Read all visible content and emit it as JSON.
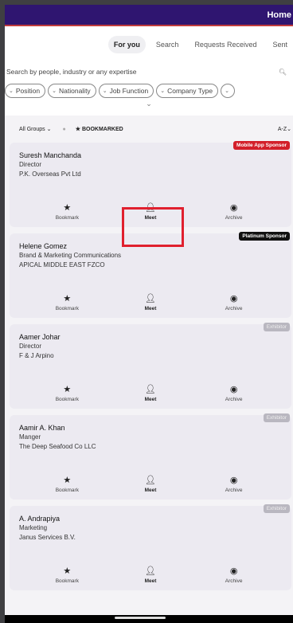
{
  "header": {
    "title": "Home"
  },
  "tabs": [
    {
      "label": "For you",
      "active": true
    },
    {
      "label": "Search",
      "active": false
    },
    {
      "label": "Requests Received",
      "active": false
    },
    {
      "label": "Sent",
      "active": false
    }
  ],
  "search": {
    "placeholder": "Search by people, industry or any expertise"
  },
  "filters": [
    "Position",
    "Nationality",
    "Job Function",
    "Company Type",
    ""
  ],
  "filter_bar": {
    "groups": "All Groups",
    "bookmarked": "★ BOOKMARKED",
    "sort": "A-Z"
  },
  "actions": {
    "bookmark": "Bookmark",
    "meet": "Meet",
    "archive": "Archive"
  },
  "cards": [
    {
      "name": "Suresh Manchanda",
      "title": "Director",
      "company": "P.K. Overseas Pvt Ltd",
      "badge": "Mobile App Sponsor",
      "badge_style": "red"
    },
    {
      "name": "Helene Gomez",
      "title": "Brand & Marketing Communications",
      "company": "APICAL MIDDLE EAST FZCO",
      "badge": "Platinum Sponsor",
      "badge_style": "black"
    },
    {
      "name": "Aamer Johar",
      "title": "Director",
      "company": "F & J Arpino",
      "badge": "Exhibitor",
      "badge_style": "grey"
    },
    {
      "name": "Aamir A. Khan",
      "title": "Manger",
      "company": "The Deep Seafood Co LLC",
      "badge": "Exhibitor",
      "badge_style": "grey"
    },
    {
      "name": "A. Andrapiya",
      "title": "Marketing",
      "company": "Janus Services B.V.",
      "badge": "Exhibitor",
      "badge_style": "grey"
    }
  ],
  "colors": {
    "topbar": "#2f1570",
    "accent": "#c23c3c",
    "sponsor_red": "#d31f2a",
    "highlight": "#e0202e"
  }
}
